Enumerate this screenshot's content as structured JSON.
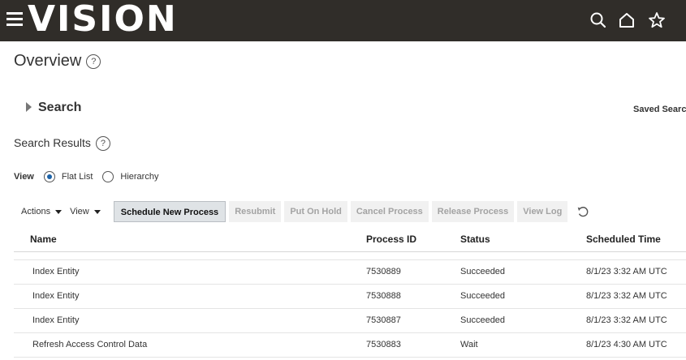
{
  "header": {
    "logo": "VISION",
    "icons": [
      "hamburger-menu-icon",
      "search-icon",
      "home-icon",
      "star-icon"
    ]
  },
  "page": {
    "title": "Overview"
  },
  "search": {
    "label": "Search",
    "saved_search_label": "Saved Searc"
  },
  "results": {
    "title": "Search Results"
  },
  "view_mode": {
    "label": "View",
    "options": [
      "Flat List",
      "Hierarchy"
    ],
    "selected": "Flat List"
  },
  "toolbar": {
    "actions_label": "Actions",
    "view_label": "View",
    "schedule_label": "Schedule New Process",
    "resubmit_label": "Resubmit",
    "hold_label": "Put On Hold",
    "cancel_label": "Cancel Process",
    "release_label": "Release Process",
    "viewlog_label": "View Log"
  },
  "table": {
    "columns": [
      "Name",
      "Process ID",
      "Status",
      "Scheduled Time"
    ],
    "rows": [
      {
        "name": "Index Entity",
        "process_id": "7530889",
        "status": "Succeeded",
        "time": "8/1/23 3:32 AM UTC"
      },
      {
        "name": "Index Entity",
        "process_id": "7530888",
        "status": "Succeeded",
        "time": "8/1/23 3:32 AM UTC"
      },
      {
        "name": "Index Entity",
        "process_id": "7530887",
        "status": "Succeeded",
        "time": "8/1/23 3:32 AM UTC"
      },
      {
        "name": "Refresh Access Control Data",
        "process_id": "7530883",
        "status": "Wait",
        "time": "8/1/23 4:30 AM UTC"
      }
    ]
  },
  "colors": {
    "header_bg": "#302d29",
    "accent": "#1d63a8",
    "primary_button_bg": "#dfe3e6"
  }
}
